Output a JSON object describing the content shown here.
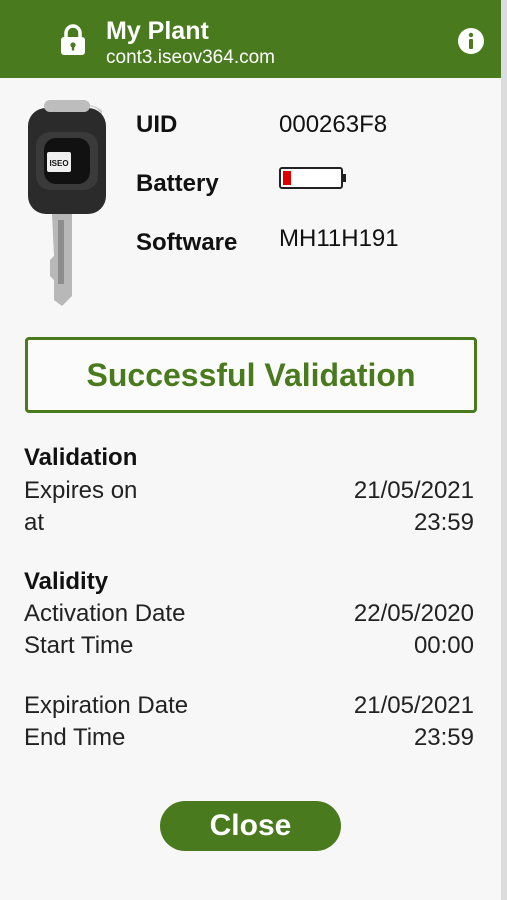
{
  "header": {
    "title": "My Plant",
    "subtitle": "cont3.iseov364.com",
    "lock_icon": "lock-icon",
    "info_icon": "info-icon"
  },
  "key": {
    "image": "key-fob-icon",
    "brand": "ISEO",
    "uid_label": "UID",
    "uid_value": "000263F8",
    "battery_label": "Battery",
    "battery_level": 0.15,
    "battery_color": "#e00000",
    "software_label": "Software",
    "software_value": "MH11H191"
  },
  "status": {
    "text": "Successful Validation",
    "color": "#4a7a1e"
  },
  "validation": {
    "heading": "Validation",
    "expires_label": "Expires on",
    "expires_value": "21/05/2021",
    "at_label": "at",
    "at_value": "23:59"
  },
  "validity": {
    "heading": "Validity",
    "activation_label": "Activation Date",
    "activation_value": "22/05/2020",
    "start_label": "Start Time",
    "start_value": "00:00",
    "expiration_label": "Expiration Date",
    "expiration_value": "21/05/2021",
    "end_label": "End Time",
    "end_value": "23:59"
  },
  "actions": {
    "close_label": "Close"
  }
}
